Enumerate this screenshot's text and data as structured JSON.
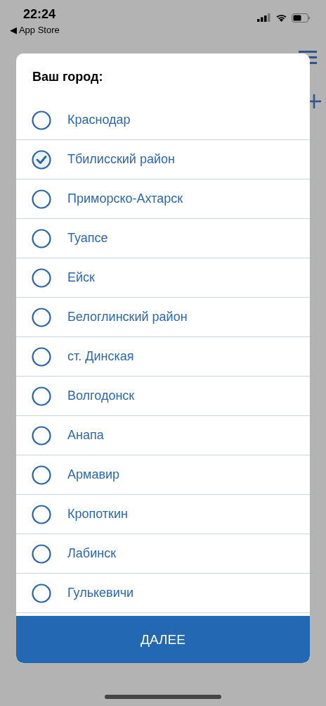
{
  "status_bar": {
    "time": "22:24",
    "back_link": "◀ App Store"
  },
  "dialog": {
    "title": "Ваш город:",
    "options": [
      {
        "label": "Краснодар",
        "selected": false
      },
      {
        "label": "Тбилисский район",
        "selected": true
      },
      {
        "label": "Приморско-Ахтарск",
        "selected": false
      },
      {
        "label": "Туапсе",
        "selected": false
      },
      {
        "label": "Ейск",
        "selected": false
      },
      {
        "label": "Белоглинский район",
        "selected": false
      },
      {
        "label": "ст. Динская",
        "selected": false
      },
      {
        "label": "Волгодонск",
        "selected": false
      },
      {
        "label": "Анапа",
        "selected": false
      },
      {
        "label": "Армавир",
        "selected": false
      },
      {
        "label": "Кропоткин",
        "selected": false
      },
      {
        "label": "Лабинск",
        "selected": false
      },
      {
        "label": "Гулькевичи",
        "selected": false
      }
    ],
    "button": "ДАЛЕЕ"
  }
}
